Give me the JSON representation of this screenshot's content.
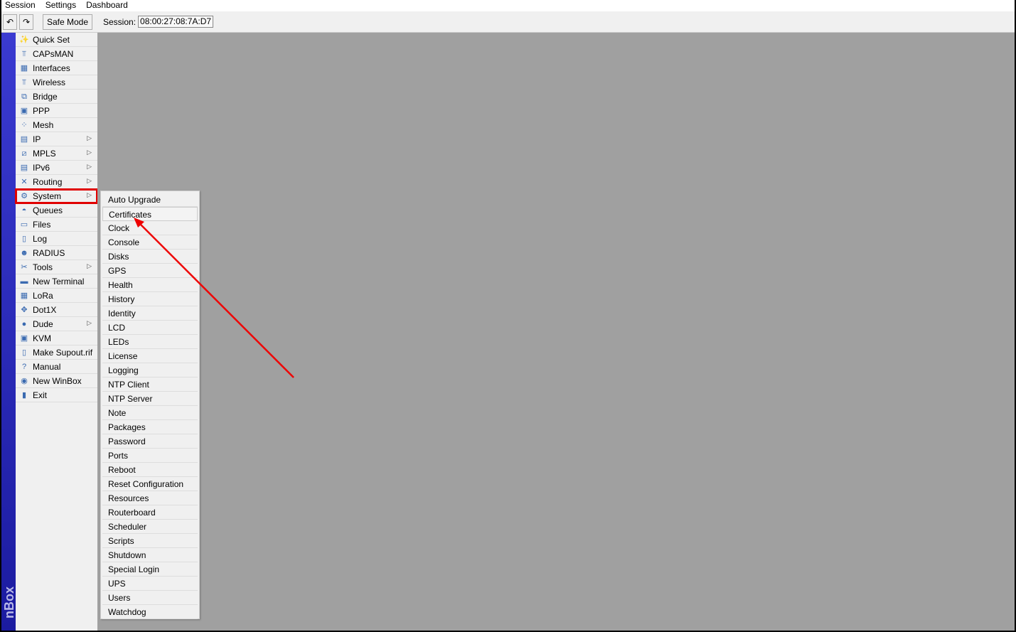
{
  "menubar": [
    "Session",
    "Settings",
    "Dashboard"
  ],
  "toolbar": {
    "undo_icon": "undo-icon",
    "redo_icon": "redo-icon",
    "safe_mode": "Safe Mode",
    "session_label": "Session:",
    "session_value": "08:00:27:08:7A:D7"
  },
  "strip_label": "nBox",
  "sidebar": [
    {
      "label": "Quick Set",
      "icon": "wand-icon",
      "sub": false
    },
    {
      "label": "CAPsMAN",
      "icon": "antenna-icon",
      "sub": false
    },
    {
      "label": "Interfaces",
      "icon": "nic-icon",
      "sub": false
    },
    {
      "label": "Wireless",
      "icon": "antenna-icon",
      "sub": false
    },
    {
      "label": "Bridge",
      "icon": "bridge-icon",
      "sub": false
    },
    {
      "label": "PPP",
      "icon": "ppp-icon",
      "sub": false
    },
    {
      "label": "Mesh",
      "icon": "mesh-icon",
      "sub": false
    },
    {
      "label": "IP",
      "icon": "ip-icon",
      "sub": true
    },
    {
      "label": "MPLS",
      "icon": "mpls-icon",
      "sub": true
    },
    {
      "label": "IPv6",
      "icon": "ipv6-icon",
      "sub": true
    },
    {
      "label": "Routing",
      "icon": "routing-icon",
      "sub": true
    },
    {
      "label": "System",
      "icon": "gear-icon",
      "sub": true,
      "selected": true
    },
    {
      "label": "Queues",
      "icon": "gauge-icon",
      "sub": false
    },
    {
      "label": "Files",
      "icon": "folder-icon",
      "sub": false
    },
    {
      "label": "Log",
      "icon": "log-icon",
      "sub": false
    },
    {
      "label": "RADIUS",
      "icon": "users-icon",
      "sub": false
    },
    {
      "label": "Tools",
      "icon": "tools-icon",
      "sub": true
    },
    {
      "label": "New Terminal",
      "icon": "terminal-icon",
      "sub": false
    },
    {
      "label": "LoRa",
      "icon": "nic-icon",
      "sub": false
    },
    {
      "label": "Dot1X",
      "icon": "dot1x-icon",
      "sub": false
    },
    {
      "label": "Dude",
      "icon": "dude-icon",
      "sub": true
    },
    {
      "label": "KVM",
      "icon": "kvm-icon",
      "sub": false
    },
    {
      "label": "Make Supout.rif",
      "icon": "file-icon",
      "sub": false
    },
    {
      "label": "Manual",
      "icon": "help-icon",
      "sub": false
    },
    {
      "label": "New WinBox",
      "icon": "winbox-icon",
      "sub": false
    },
    {
      "label": "Exit",
      "icon": "exit-icon",
      "sub": false
    }
  ],
  "system_submenu": [
    "Auto Upgrade",
    "Certificates",
    "Clock",
    "Console",
    "Disks",
    "GPS",
    "Health",
    "History",
    "Identity",
    "LCD",
    "LEDs",
    "License",
    "Logging",
    "NTP Client",
    "NTP Server",
    "Note",
    "Packages",
    "Password",
    "Ports",
    "Reboot",
    "Reset Configuration",
    "Resources",
    "Routerboard",
    "Scheduler",
    "Scripts",
    "Shutdown",
    "Special Login",
    "UPS",
    "Users",
    "Watchdog"
  ],
  "highlighted_submenu": "Certificates",
  "colors": {
    "highlight": "#e00000",
    "strip": "#2a2ab8",
    "workspace": "#a0a0a0"
  }
}
